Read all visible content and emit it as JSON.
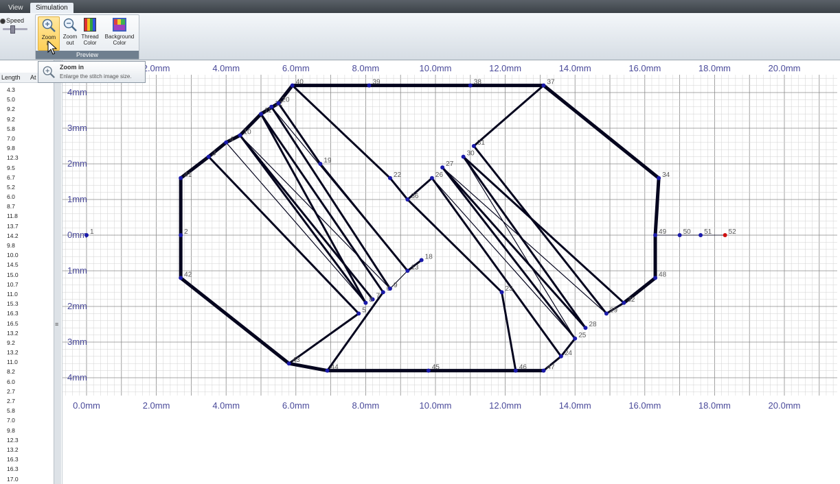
{
  "tabs": [
    {
      "label": "View"
    },
    {
      "label": "Simulation"
    }
  ],
  "ribbon": {
    "speed_label": "Speed",
    "group_label": "Preview",
    "buttons": [
      {
        "line1": "Zoom",
        "line2": "in",
        "icon": "zoom-in-icon"
      },
      {
        "line1": "Zoom",
        "line2": "out",
        "icon": "zoom-out-icon"
      },
      {
        "line1": "Thread",
        "line2": "Color",
        "icon": "thread-color-icon"
      },
      {
        "line1": "Background",
        "line2": "Color",
        "icon": "background-color-icon"
      }
    ]
  },
  "tooltip": {
    "title": "Zoom in",
    "text": "Enlarge the stitch image size."
  },
  "left_panel": {
    "col_length": "Length",
    "col_attr": "At",
    "lengths": [
      "4.3",
      "5.0",
      "9.2",
      "9.2",
      "5.8",
      "7.0",
      "9.8",
      "12.3",
      "9.5",
      "6.7",
      "5.2",
      "6.0",
      "8.7",
      "11.8",
      "13.7",
      "14.2",
      "9.8",
      "10.0",
      "14.5",
      "15.0",
      "10.7",
      "11.0",
      "15.3",
      "16.3",
      "16.5",
      "13.2",
      "9.2",
      "13.2",
      "11.0",
      "8.2",
      "6.0",
      "2.7",
      "2.7",
      "5.8",
      "7.0",
      "9.8",
      "12.3",
      "13.2",
      "16.3",
      "16.3",
      "17.0"
    ]
  },
  "canvas": {
    "x_axis_labels": [
      "0.0mm",
      "2.0mm",
      "4.0mm",
      "6.0mm",
      "8.0mm",
      "10.0mm",
      "12.0mm",
      "14.0mm",
      "16.0mm",
      "18.0mm",
      "20.0mm"
    ],
    "y_axis_labels": [
      "4mm",
      "3mm",
      "2mm",
      "1mm",
      "0mm",
      "1mm",
      "2mm",
      "3mm",
      "4mm"
    ],
    "colors": {
      "stitch": "#05051e",
      "point": "#1a1aaa",
      "end_point": "#d01010",
      "grid_major": "#8a8a8a",
      "grid_minor": "#d2d2d2",
      "label": "#4a4a9a"
    },
    "points": [
      {
        "n": "1",
        "x": 0.0,
        "y": 0.0
      },
      {
        "n": "2",
        "x": 2.7,
        "y": 0.0
      },
      {
        "n": "3",
        "x": 3.5,
        "y": 2.2
      },
      {
        "n": "4",
        "x": 4.0,
        "y": 2.6
      },
      {
        "n": "5",
        "x": 7.8,
        "y": -2.2
      },
      {
        "n": "6",
        "x": 8.5,
        "y": -1.6
      },
      {
        "n": "7",
        "x": 8.2,
        "y": -1.8
      },
      {
        "n": "8",
        "x": 8.0,
        "y": -1.9
      },
      {
        "n": "9",
        "x": 8.7,
        "y": -1.5
      },
      {
        "n": "10",
        "x": 4.4,
        "y": 2.8
      },
      {
        "n": "11",
        "x": 5.0,
        "y": 3.4
      },
      {
        "n": "12",
        "x": 5.3,
        "y": 3.6
      },
      {
        "n": "13",
        "x": 9.2,
        "y": -1.0
      },
      {
        "n": "18",
        "x": 9.6,
        "y": -0.7
      },
      {
        "n": "19",
        "x": 6.7,
        "y": 2.0
      },
      {
        "n": "20",
        "x": 5.5,
        "y": 3.7
      },
      {
        "n": "22",
        "x": 8.7,
        "y": 1.6
      },
      {
        "n": "23",
        "x": 11.9,
        "y": -1.6
      },
      {
        "n": "24",
        "x": 13.6,
        "y": -3.4
      },
      {
        "n": "25",
        "x": 14.0,
        "y": -2.9
      },
      {
        "n": "26",
        "x": 9.9,
        "y": 1.6
      },
      {
        "n": "27",
        "x": 10.2,
        "y": 1.9
      },
      {
        "n": "28",
        "x": 14.3,
        "y": -2.6
      },
      {
        "n": "29",
        "x": 14.9,
        "y": -2.2
      },
      {
        "n": "30",
        "x": 10.8,
        "y": 2.2
      },
      {
        "n": "31",
        "x": 11.1,
        "y": 2.5
      },
      {
        "n": "32",
        "x": 15.4,
        "y": -1.9
      },
      {
        "n": "34",
        "x": 16.4,
        "y": 1.6
      },
      {
        "n": "36",
        "x": 9.2,
        "y": 1.0
      },
      {
        "n": "37",
        "x": 13.1,
        "y": 4.2
      },
      {
        "n": "38",
        "x": 11.0,
        "y": 4.2
      },
      {
        "n": "39",
        "x": 8.1,
        "y": 4.2
      },
      {
        "n": "40",
        "x": 5.9,
        "y": 4.2
      },
      {
        "n": "41",
        "x": 2.7,
        "y": 1.6
      },
      {
        "n": "42",
        "x": 2.7,
        "y": -1.2
      },
      {
        "n": "43",
        "x": 5.8,
        "y": -3.6
      },
      {
        "n": "44",
        "x": 6.9,
        "y": -3.8
      },
      {
        "n": "45",
        "x": 9.8,
        "y": -3.8
      },
      {
        "n": "46",
        "x": 12.3,
        "y": -3.8
      },
      {
        "n": "47",
        "x": 13.1,
        "y": -3.8
      },
      {
        "n": "48",
        "x": 16.3,
        "y": -1.2
      },
      {
        "n": "49",
        "x": 16.3,
        "y": 0.0
      },
      {
        "n": "50",
        "x": 17.0,
        "y": 0.0
      },
      {
        "n": "51",
        "x": 17.6,
        "y": 0.0
      },
      {
        "n": "52",
        "x": 18.3,
        "y": 0.0
      }
    ]
  }
}
